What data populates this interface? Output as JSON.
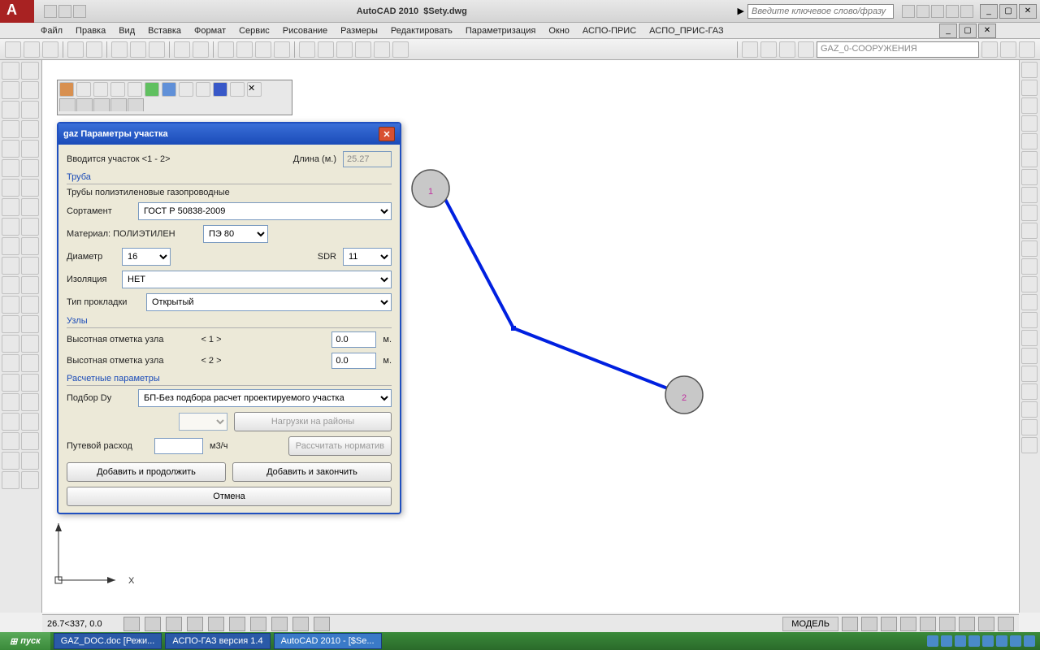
{
  "titlebar": {
    "app": "AutoCAD 2010",
    "file": "$Sety.dwg",
    "search_placeholder": "Введите ключевое слово/фразу"
  },
  "menu": [
    "Файл",
    "Правка",
    "Вид",
    "Вставка",
    "Формат",
    "Сервис",
    "Рисование",
    "Размеры",
    "Редактировать",
    "Параметризация",
    "Окно",
    "АСПО-ПРИС",
    "АСПО_ПРИС-ГАЗ"
  ],
  "layer_combo": "GAZ_0-СООРУЖЕНИЯ",
  "dialog": {
    "title": "gaz Параметры участка",
    "section_intro": "Вводится участок <1 - 2>",
    "length_label": "Длина (м.)",
    "length_value": "25.27",
    "pipe_header": "Труба",
    "pipe_desc": "Трубы полиэтиленовые газопроводные",
    "sortament_label": "Сортамент",
    "sortament_value": "ГОСТ Р 50838-2009",
    "material_label": "Материал: ПОЛИЭТИЛЕН",
    "material_value": "ПЭ 80",
    "diameter_label": "Диаметр",
    "diameter_value": "16",
    "sdr_label": "SDR",
    "sdr_value": "11",
    "isolation_label": "Изоляция",
    "isolation_value": "НЕТ",
    "laying_label": "Тип прокладки",
    "laying_value": "Открытый",
    "nodes_header": "Узлы",
    "elev_label": "Высотная отметка узла",
    "node1": "< 1 >",
    "node2": "< 2 >",
    "elev1_value": "0.0",
    "elev2_value": "0.0",
    "unit_m": "м.",
    "calc_header": "Расчетные параметры",
    "podbor_label": "Подбор Dy",
    "podbor_value": "БП-Без подбора расчет проектируемого участка",
    "loads_btn": "Нагрузки на районы",
    "flow_label": "Путевой расход",
    "flow_unit": "м3/ч",
    "calc_norm_btn": "Рассчитать норматив",
    "add_continue": "Добавить и продолжить",
    "add_finish": "Добавить и закончить",
    "cancel": "Отмена"
  },
  "canvas": {
    "node1_label": "1",
    "node2_label": "2",
    "axis_x": "X"
  },
  "status": {
    "coords": "26.7<337, 0.0",
    "model": "МОДЕЛЬ"
  },
  "taskbar": {
    "start": "пуск",
    "items": [
      "GAZ_DOC.doc [Режи...",
      "АСПО-ГАЗ версия 1.4",
      "AutoCAD 2010 - [$Se..."
    ]
  }
}
